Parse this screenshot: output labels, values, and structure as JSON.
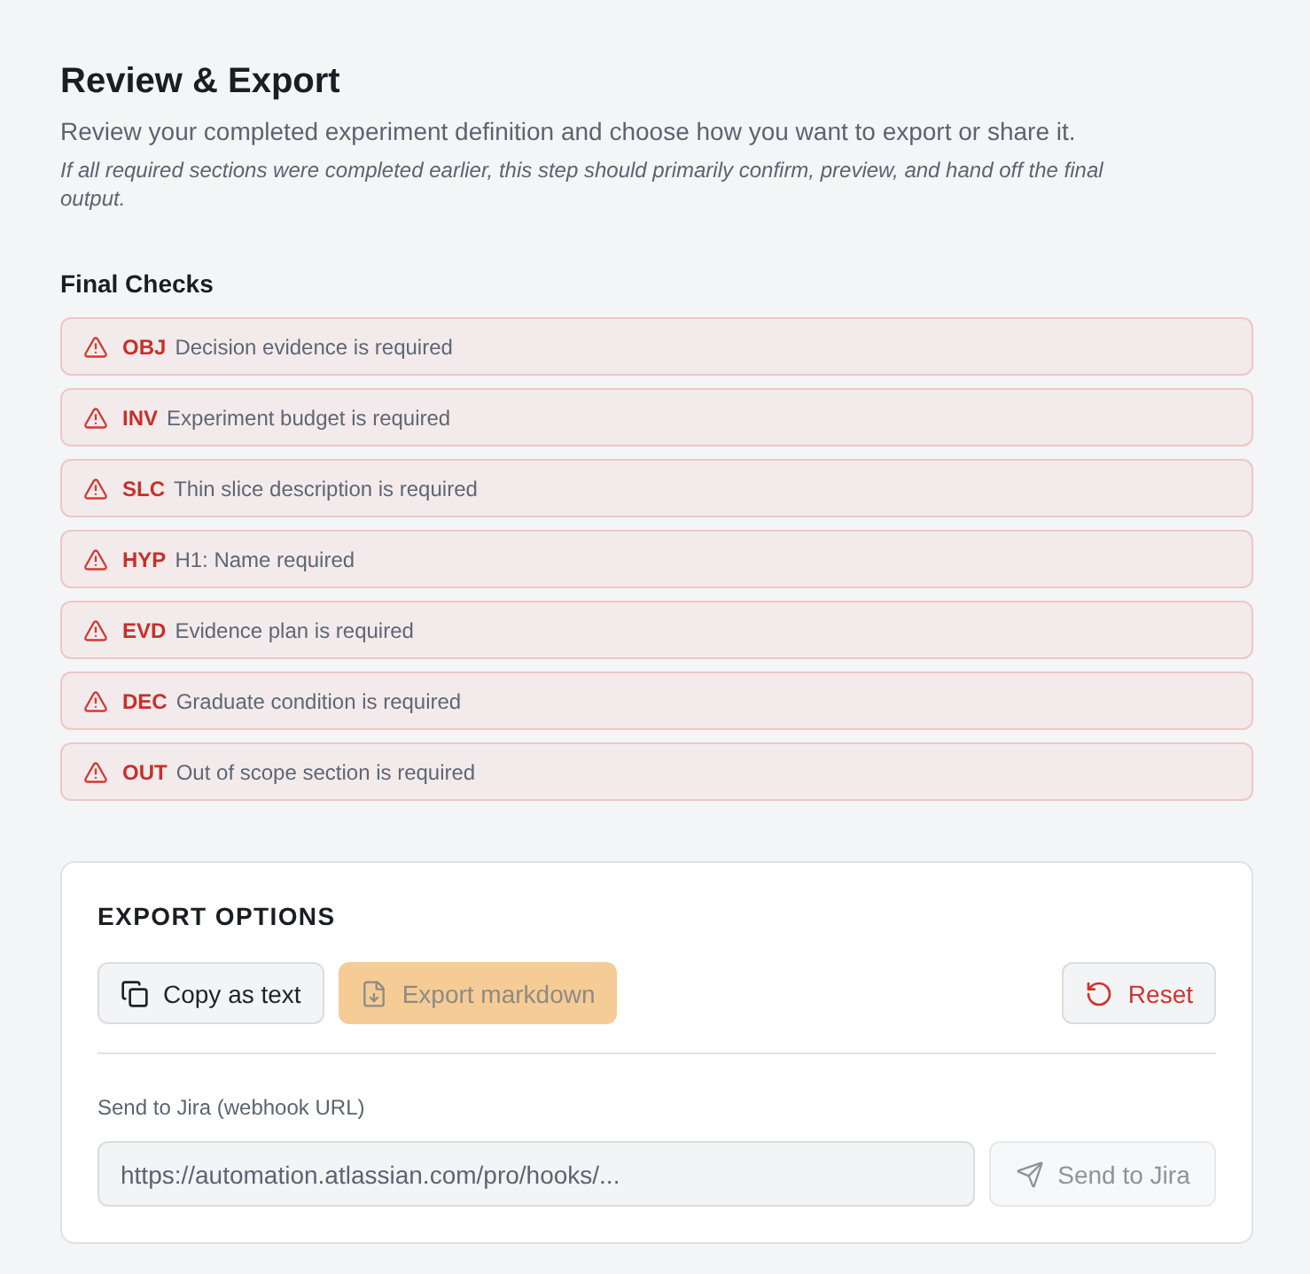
{
  "page": {
    "title": "Review & Export",
    "subtitle": "Review your completed experiment definition and choose how you want to export or share it.",
    "note": "If all required sections were completed earlier, this step should primarily confirm, preview, and hand off the final output."
  },
  "final_checks": {
    "heading": "Final Checks",
    "items": [
      {
        "code": "OBJ",
        "message": "Decision evidence is required"
      },
      {
        "code": "INV",
        "message": "Experiment budget is required"
      },
      {
        "code": "SLC",
        "message": "Thin slice description is required"
      },
      {
        "code": "HYP",
        "message": "H1: Name required"
      },
      {
        "code": "EVD",
        "message": "Evidence plan is required"
      },
      {
        "code": "DEC",
        "message": "Graduate condition is required"
      },
      {
        "code": "OUT",
        "message": "Out of scope section is required"
      }
    ]
  },
  "export_options": {
    "heading": "EXPORT OPTIONS",
    "buttons": [
      {
        "kind": "copy",
        "label": "Copy as text",
        "disabled": false
      },
      {
        "kind": "export",
        "label": "Export markdown",
        "disabled": true
      },
      {
        "kind": "reset",
        "label": "Reset",
        "disabled": false
      }
    ],
    "jira": {
      "label": "Send to Jira (webhook URL)",
      "placeholder": "https://automation.atlassian.com/pro/hooks/...",
      "button": {
        "label": "Send to Jira",
        "disabled": true
      }
    }
  }
}
